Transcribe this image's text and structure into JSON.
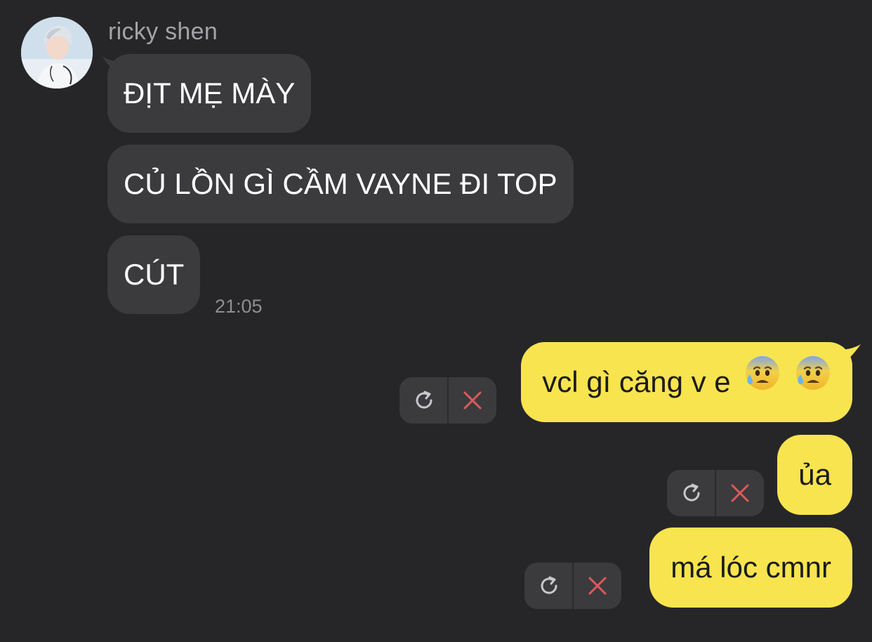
{
  "conversation": {
    "sender": {
      "name": "ricky shen",
      "avatar_icon": "profile-photo"
    },
    "incoming": [
      {
        "text": "ĐỊT MẸ MÀY"
      },
      {
        "text": "CỦ LỒN GÌ CẦM VAYNE ĐI TOP"
      },
      {
        "text": "CÚT"
      }
    ],
    "incoming_time": "21:05",
    "outgoing": [
      {
        "text": "vcl gì căng v e",
        "emoji": [
          "anxious-face-with-sweat",
          "anxious-face-with-sweat"
        ],
        "status": "failed"
      },
      {
        "text": "ủa",
        "status": "failed"
      },
      {
        "text": "má lóc cmnr",
        "status": "failed"
      }
    ],
    "failed_actions": {
      "retry_icon": "refresh-icon",
      "cancel_icon": "close-icon"
    }
  },
  "colors": {
    "background": "#262628",
    "incoming_bubble": "#3b3b3e",
    "outgoing_bubble": "#f7e44f",
    "cancel_icon": "#e0595b",
    "retry_icon": "#c8c8cc",
    "secondary_text": "#8e8e93"
  }
}
